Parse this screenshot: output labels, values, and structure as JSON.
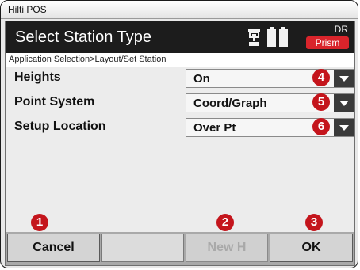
{
  "window": {
    "title": "Hilti POS"
  },
  "header": {
    "title": "Select Station Type",
    "instrument_icon": "total-station-icon",
    "battery_icon": "battery-icon",
    "mode_top": "DR",
    "mode_bottom": "Prism",
    "accent": "#d9242b"
  },
  "breadcrumb": "Application Selection>Layout/Set Station",
  "fields": [
    {
      "label": "Heights",
      "value": "On",
      "badge": "4"
    },
    {
      "label": "Point System",
      "value": "Coord/Graph",
      "badge": "5"
    },
    {
      "label": "Setup Location",
      "value": "Over Pt",
      "badge": "6"
    }
  ],
  "buttons": [
    {
      "label": "Cancel",
      "badge": "1",
      "enabled": true
    },
    {
      "label": "New H",
      "badge": "2",
      "enabled": false
    },
    {
      "label": "OK",
      "badge": "3",
      "enabled": true
    }
  ],
  "badge_color": "#c4151c"
}
